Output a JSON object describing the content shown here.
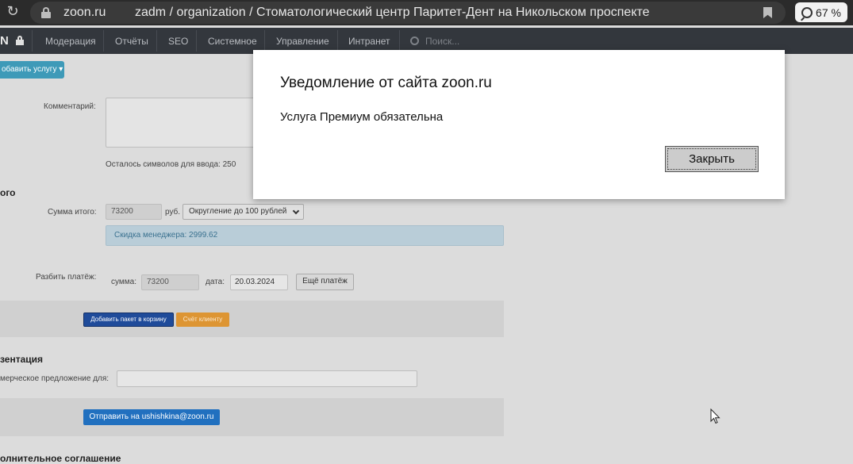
{
  "browser": {
    "url_domain": "zoon.ru",
    "tab_title": "zadm / organization / Стоматологический центр Паритет-Дент на Никольском проспекте",
    "zoom": "67 %"
  },
  "nav": {
    "brand": "N",
    "items": [
      "Модерация",
      "Отчёты",
      "SEO",
      "Системное",
      "Управление",
      "Интранет"
    ],
    "search_placeholder": "Поиск..."
  },
  "form": {
    "add_service_button": "обавить услугу ▾",
    "comment_label": "Комментарий:",
    "chars_left": "Осталось символов для ввода: 250",
    "total_heading": "ого",
    "total_label": "Сумма итого:",
    "total_value": "73200",
    "currency": "руб.",
    "rounding_option": "Округление до 100 рублей",
    "manager_discount": "Скидка менеджера: 2999.62",
    "split_label": "Разбить платёж:",
    "sum_label": "сумма:",
    "sum_value": "73200",
    "date_label": "дата:",
    "date_value": "20.03.2024",
    "more_payment_button": "Ещё платёж",
    "add_package_button": "Добавить пакет в корзину",
    "client_invoice_button": "Счёт клиенту",
    "presentation_heading": "зентация",
    "offer_label": "мерческое предложение для:",
    "offer_value": "",
    "send_button": "Отправить на ushishkina@zoon.ru",
    "agreement_heading": "олнительное соглашение"
  },
  "dialog": {
    "title": "Уведомление от сайта zoon.ru",
    "message": "Услуга Премиум обязательна",
    "close_button": "Закрыть"
  },
  "colors": {
    "nav_bg": "#33373d",
    "primary_blue": "#2170bf",
    "navy": "#1f4b9a",
    "orange": "#dd9533",
    "info_bg": "#b9cdd8"
  }
}
